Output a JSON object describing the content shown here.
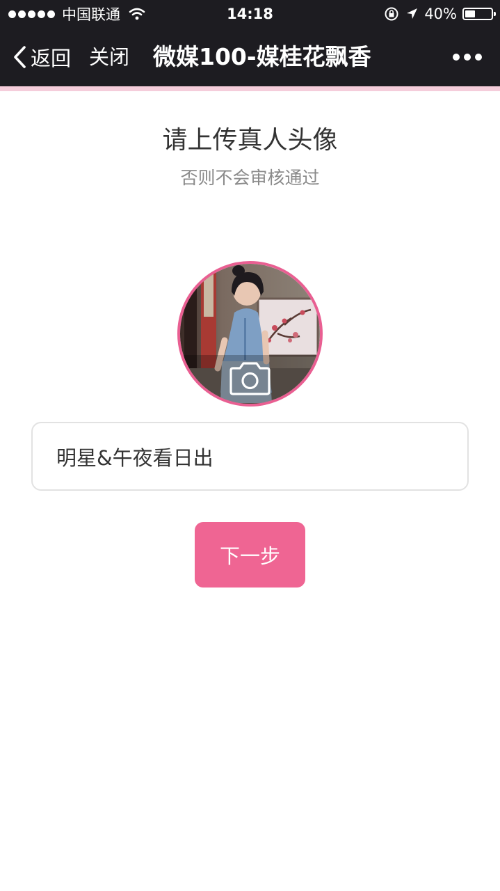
{
  "status_bar": {
    "carrier": "中国联通",
    "time": "14:18",
    "battery_text": "40%",
    "battery_level": 0.4,
    "icons": [
      "signal-dots",
      "wifi-icon",
      "orientation-lock-icon",
      "location-icon",
      "battery-icon"
    ]
  },
  "nav": {
    "back_label": "返回",
    "close_label": "关闭",
    "title": "微媒100-媒桂花飘香",
    "more_icon": "more-icon"
  },
  "content": {
    "heading": "请上传真人头像",
    "subheading": "否则不会审核通过",
    "avatar_overlay_icon": "camera-icon",
    "name_value": "明星&午夜看日出",
    "next_label": "下一步"
  },
  "colors": {
    "accent": "#ef6593",
    "avatar_border": "#e95f92",
    "nav_background": "#1d1c21",
    "strip": "#f5cddb"
  }
}
